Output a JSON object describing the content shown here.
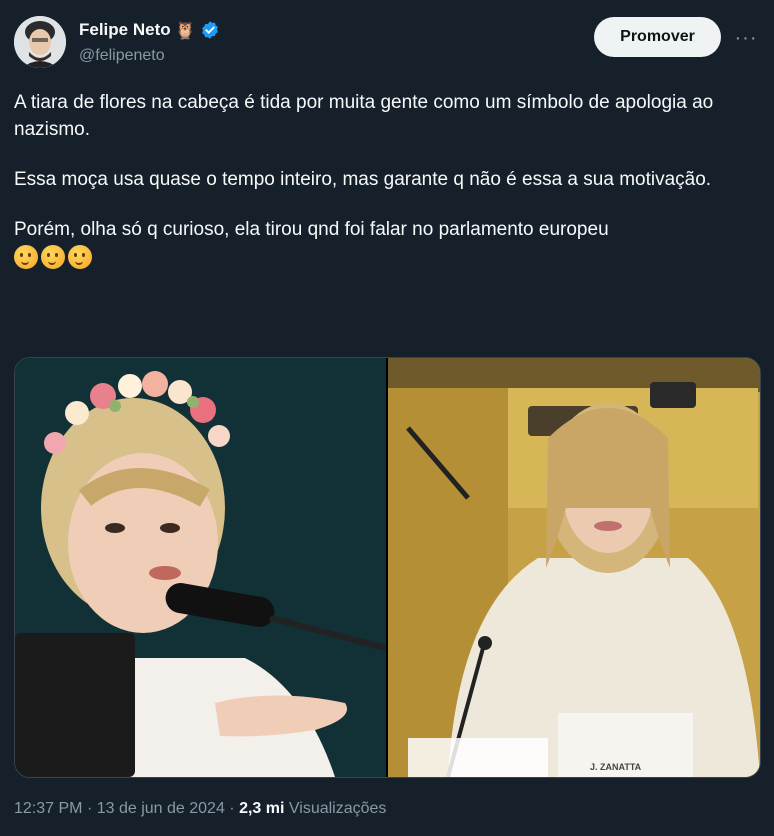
{
  "author": {
    "display_name": "Felipe Neto",
    "handle": "@felipeneto",
    "badge_emoji": "🦉"
  },
  "actions": {
    "promote_label": "Promover",
    "more_label": "···"
  },
  "post": {
    "paragraph1": "A tiara de flores na cabeça é tida por muita gente como um símbolo de apologia ao nazismo.",
    "paragraph2": "Essa moça usa quase o tempo inteiro, mas garante q não é essa a sua motivação.",
    "paragraph3": "Porém, olha só q curioso, ela tirou qnd foi falar no parlamento europeu",
    "emoji_icons": [
      "thinking-face-icon",
      "thinking-face-icon",
      "thinking-face-icon"
    ]
  },
  "media": {
    "right_nameplate": "J. ZANATTA"
  },
  "meta": {
    "time": "12:37 PM",
    "sep1": "·",
    "date": "13 de jun de 2024",
    "sep2": "·",
    "views_count": "2,3 mi",
    "views_label": "Visualizações"
  },
  "colors": {
    "background": "#15202b",
    "verified": "#1d9bf0",
    "secondary_text": "#8b98a5"
  }
}
